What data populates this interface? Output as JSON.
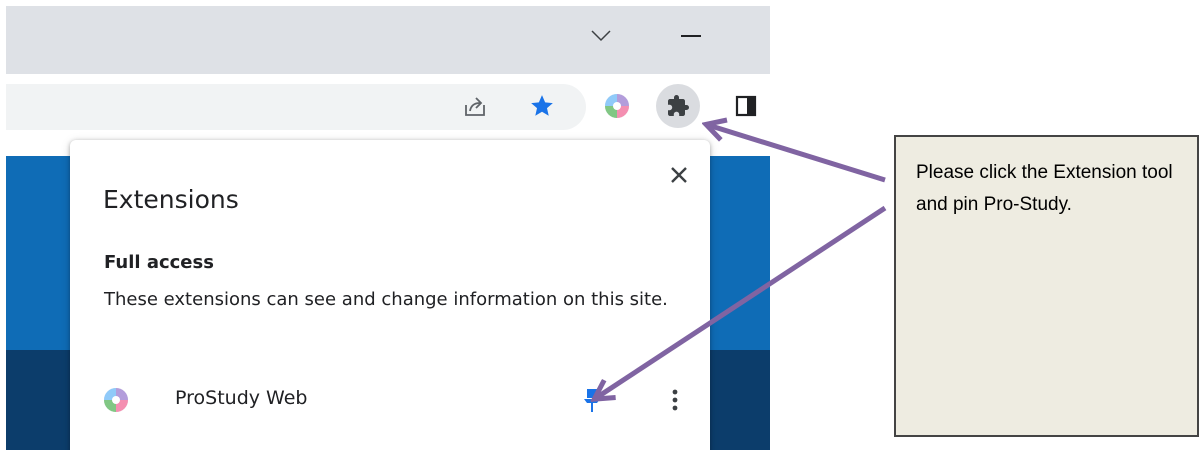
{
  "colors": {
    "titlebar_bg": "#dee1e6",
    "omnibox_bg": "#f1f3f4",
    "star_blue": "#1a73e8",
    "pin_blue": "#1a73e8",
    "page_blue": "#0f6cb6",
    "page_dark_blue": "#0c3d6b",
    "callout_bg": "#eeece1",
    "arrow_purple": "#8064a2"
  },
  "titlebar": {
    "icons": [
      "chevron-down-icon",
      "minimize-icon"
    ]
  },
  "toolbar": {
    "icons": [
      "share-icon",
      "bookmark-star-icon",
      "prostudy-extension-icon",
      "extensions-puzzle-icon",
      "side-panel-icon"
    ]
  },
  "extensions_popup": {
    "title": "Extensions",
    "close_icon": "close-icon",
    "section_heading": "Full access",
    "section_description": "These extensions can see and change information on this site.",
    "items": [
      {
        "name": "ProStudy Web",
        "icon": "prostudy-icon",
        "pinned": true,
        "pin_icon": "pin-icon",
        "menu_icon": "more-vert-icon"
      }
    ]
  },
  "callout": {
    "text": "Please click the Extension tool and pin Pro-Study."
  }
}
